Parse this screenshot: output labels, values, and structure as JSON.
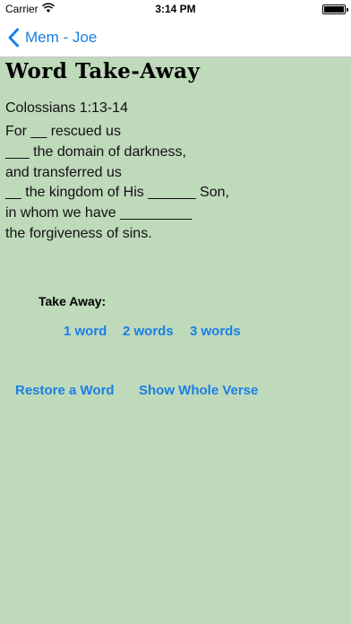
{
  "status_bar": {
    "carrier": "Carrier",
    "time": "3:14 PM"
  },
  "nav": {
    "back_label": "Mem - Joe"
  },
  "screen": {
    "title": "Word Take-Away"
  },
  "verse": {
    "reference": "Colossians 1:13-14",
    "lines": [
      "For __ rescued us",
      "___ the domain of darkness,",
      "and transferred us",
      "__ the kingdom of His ______ Son,",
      "in whom we have _________",
      "the forgiveness of sins."
    ]
  },
  "take_away": {
    "label": "Take Away:",
    "options": [
      "1 word",
      "2 words",
      "3 words"
    ]
  },
  "actions": {
    "restore": "Restore a Word",
    "show_whole": "Show Whole Verse"
  },
  "colors": {
    "background": "#bfd9bb",
    "accent": "#1a7fe6"
  }
}
